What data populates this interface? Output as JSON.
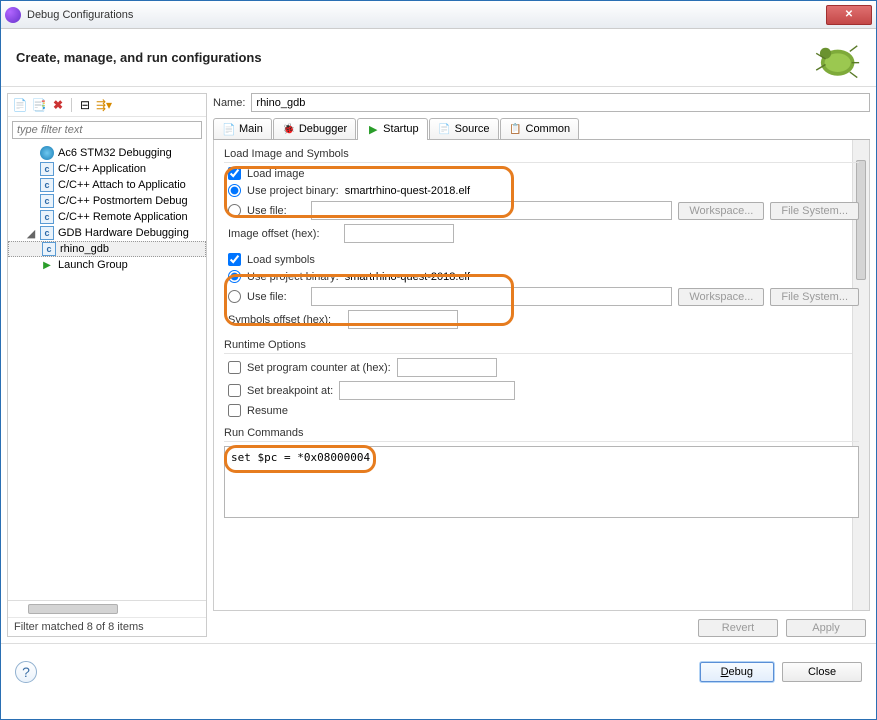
{
  "window": {
    "title": "Debug Configurations"
  },
  "header": {
    "title": "Create, manage, and run configurations"
  },
  "filter": {
    "placeholder": "type filter text",
    "status": "Filter matched 8 of 8 items"
  },
  "tree": [
    {
      "label": "Ac6 STM32 Debugging",
      "icon": "globe"
    },
    {
      "label": "C/C++ Application",
      "icon": "c"
    },
    {
      "label": "C/C++ Attach to Applicatio",
      "icon": "c"
    },
    {
      "label": "C/C++ Postmortem Debug",
      "icon": "c"
    },
    {
      "label": "C/C++ Remote Application",
      "icon": "c"
    },
    {
      "label": "GDB Hardware Debugging",
      "icon": "c",
      "expanded": true
    },
    {
      "label": "rhino_gdb",
      "icon": "c",
      "indent": 2,
      "selected": true
    },
    {
      "label": "Launch Group",
      "icon": "run"
    }
  ],
  "name": {
    "label": "Name:",
    "value": "rhino_gdb"
  },
  "tabs": [
    {
      "label": "Main",
      "icon": "file"
    },
    {
      "label": "Debugger",
      "icon": "bug"
    },
    {
      "label": "Startup",
      "icon": "play",
      "active": true
    },
    {
      "label": "Source",
      "icon": "src"
    },
    {
      "label": "Common",
      "icon": "common"
    }
  ],
  "startup": {
    "loadImageSymbols": {
      "title": "Load Image and Symbols",
      "loadImage": {
        "label": "Load image",
        "checked": true
      },
      "imageProjectBinary": {
        "label": "Use project binary:",
        "value": "smartrhino-quest-2018.elf",
        "selected": true
      },
      "imageUseFile": {
        "label": "Use file:",
        "selected": false,
        "value": ""
      },
      "workspaceBtn": "Workspace...",
      "fileSystemBtn": "File System...",
      "imageOffset": {
        "label": "Image offset (hex):",
        "value": ""
      },
      "loadSymbols": {
        "label": "Load symbols",
        "checked": true
      },
      "symProjectBinary": {
        "label": "Use project binary:",
        "value": "smartrhino-quest-2018.elf",
        "selected": true
      },
      "symUseFile": {
        "label": "Use file:",
        "selected": false,
        "value": ""
      },
      "symOffset": {
        "label": "Symbols offset (hex):",
        "value": ""
      }
    },
    "runtime": {
      "title": "Runtime Options",
      "setPc": {
        "label": "Set program counter at (hex):",
        "checked": false,
        "value": ""
      },
      "setBp": {
        "label": "Set breakpoint at:",
        "checked": false,
        "value": ""
      },
      "resume": {
        "label": "Resume",
        "checked": false
      }
    },
    "runCmds": {
      "title": "Run Commands",
      "value": "set $pc = *0x08000004"
    }
  },
  "buttons": {
    "revert": "Revert",
    "apply": "Apply",
    "debug": "Debug",
    "close": "Close"
  }
}
